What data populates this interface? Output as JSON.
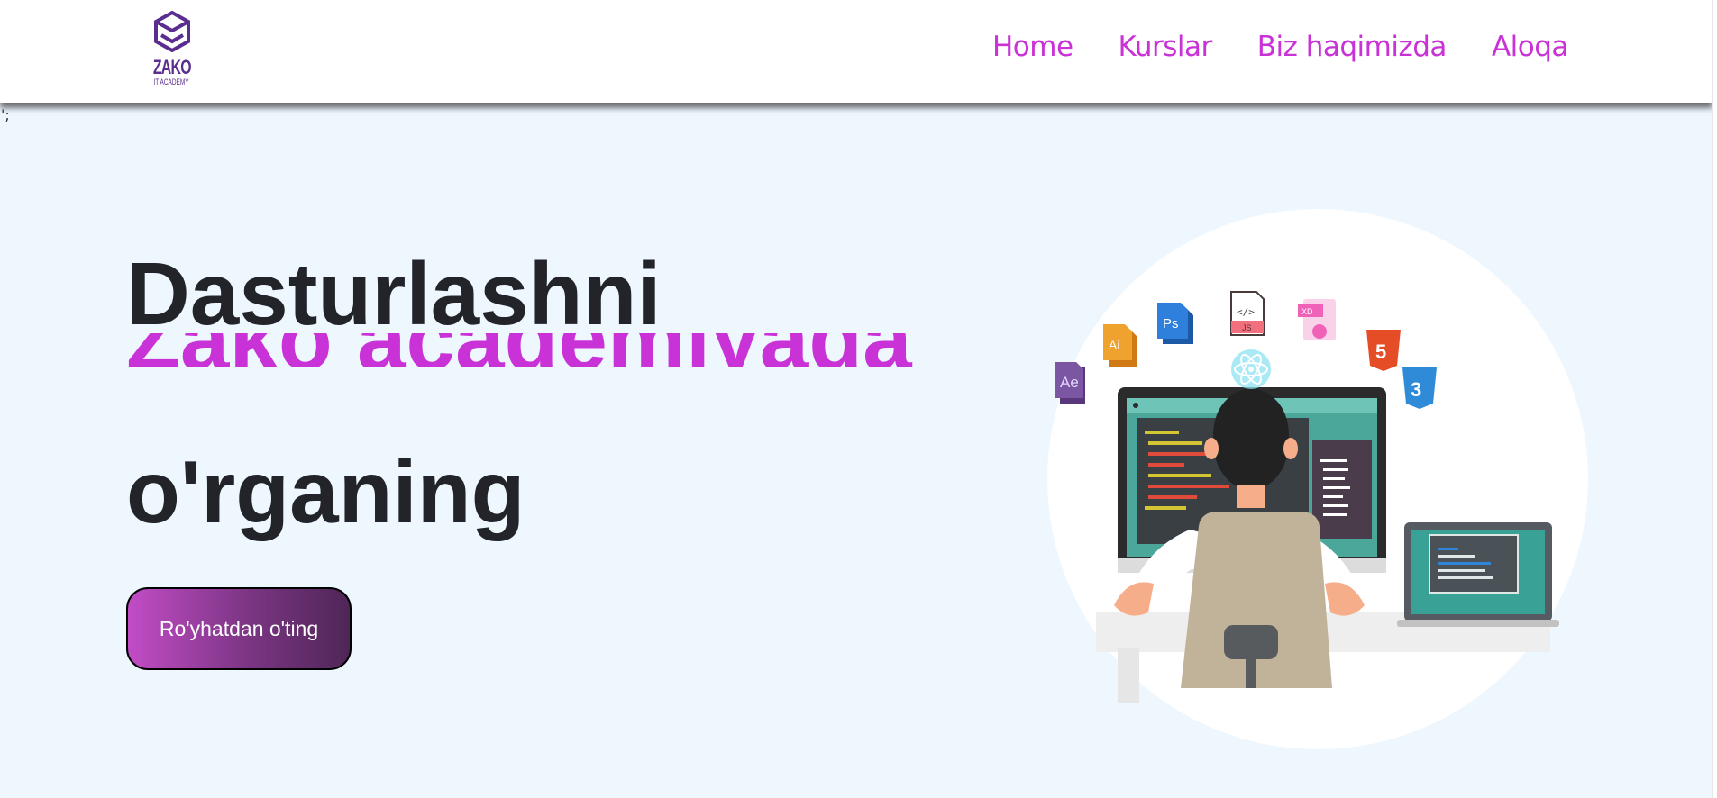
{
  "nav": {
    "logo_name": "ZAKO",
    "logo_sub": "IT ACADEMY",
    "links": [
      "Home",
      "Kurslar",
      "Biz haqimizda",
      "Aloqa"
    ]
  },
  "stray_text": "';",
  "hero": {
    "line1": "Dasturlashni",
    "line2": "Zako academiyada",
    "line3": "o'rganing",
    "cta_label": "Ro'yhatdan o'ting"
  },
  "colors": {
    "accent": "#c932d6",
    "heading": "#222429",
    "background": "#eef6fe",
    "logo": "#5a2d8e"
  },
  "illustration": {
    "icons": [
      "ae-icon",
      "ai-icon",
      "ps-icon",
      "js-file-icon",
      "xd-icon",
      "react-icon",
      "html5-icon",
      "css3-icon"
    ]
  }
}
